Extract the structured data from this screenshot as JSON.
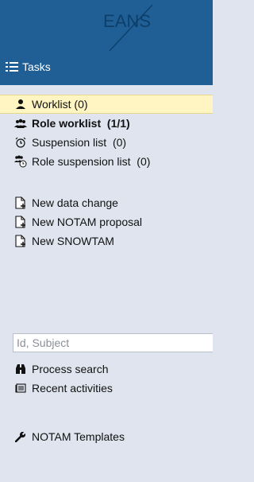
{
  "header": {
    "logo_text": "EANS",
    "title": "Tasks",
    "title_icon": "list-icon"
  },
  "lists": [
    {
      "label": "Worklist (0)",
      "icon": "user-icon"
    },
    {
      "label": "Role worklist  (1/1)",
      "icon": "group-icon"
    },
    {
      "label": "Suspension list  (0)",
      "icon": "alarm-clock-icon"
    },
    {
      "label": "Role suspension list  (0)",
      "icon": "group-clock-icon"
    }
  ],
  "actions": [
    {
      "label": "New data change",
      "icon": "new-document-icon"
    },
    {
      "label": "New NOTAM proposal",
      "icon": "new-document-icon"
    },
    {
      "label": "New SNOWTAM",
      "icon": "new-document-icon"
    }
  ],
  "search": {
    "placeholder": "Id, Subject",
    "value": ""
  },
  "tools": [
    {
      "label": "Process search",
      "icon": "binoculars-icon"
    },
    {
      "label": "Recent activities",
      "icon": "history-icon"
    },
    {
      "label": "NOTAM Templates",
      "icon": "wrench-icon"
    }
  ],
  "colors": {
    "header": "#1f5f95",
    "sidebar": "#dfe4ee",
    "active_item": "#fff5c2"
  }
}
